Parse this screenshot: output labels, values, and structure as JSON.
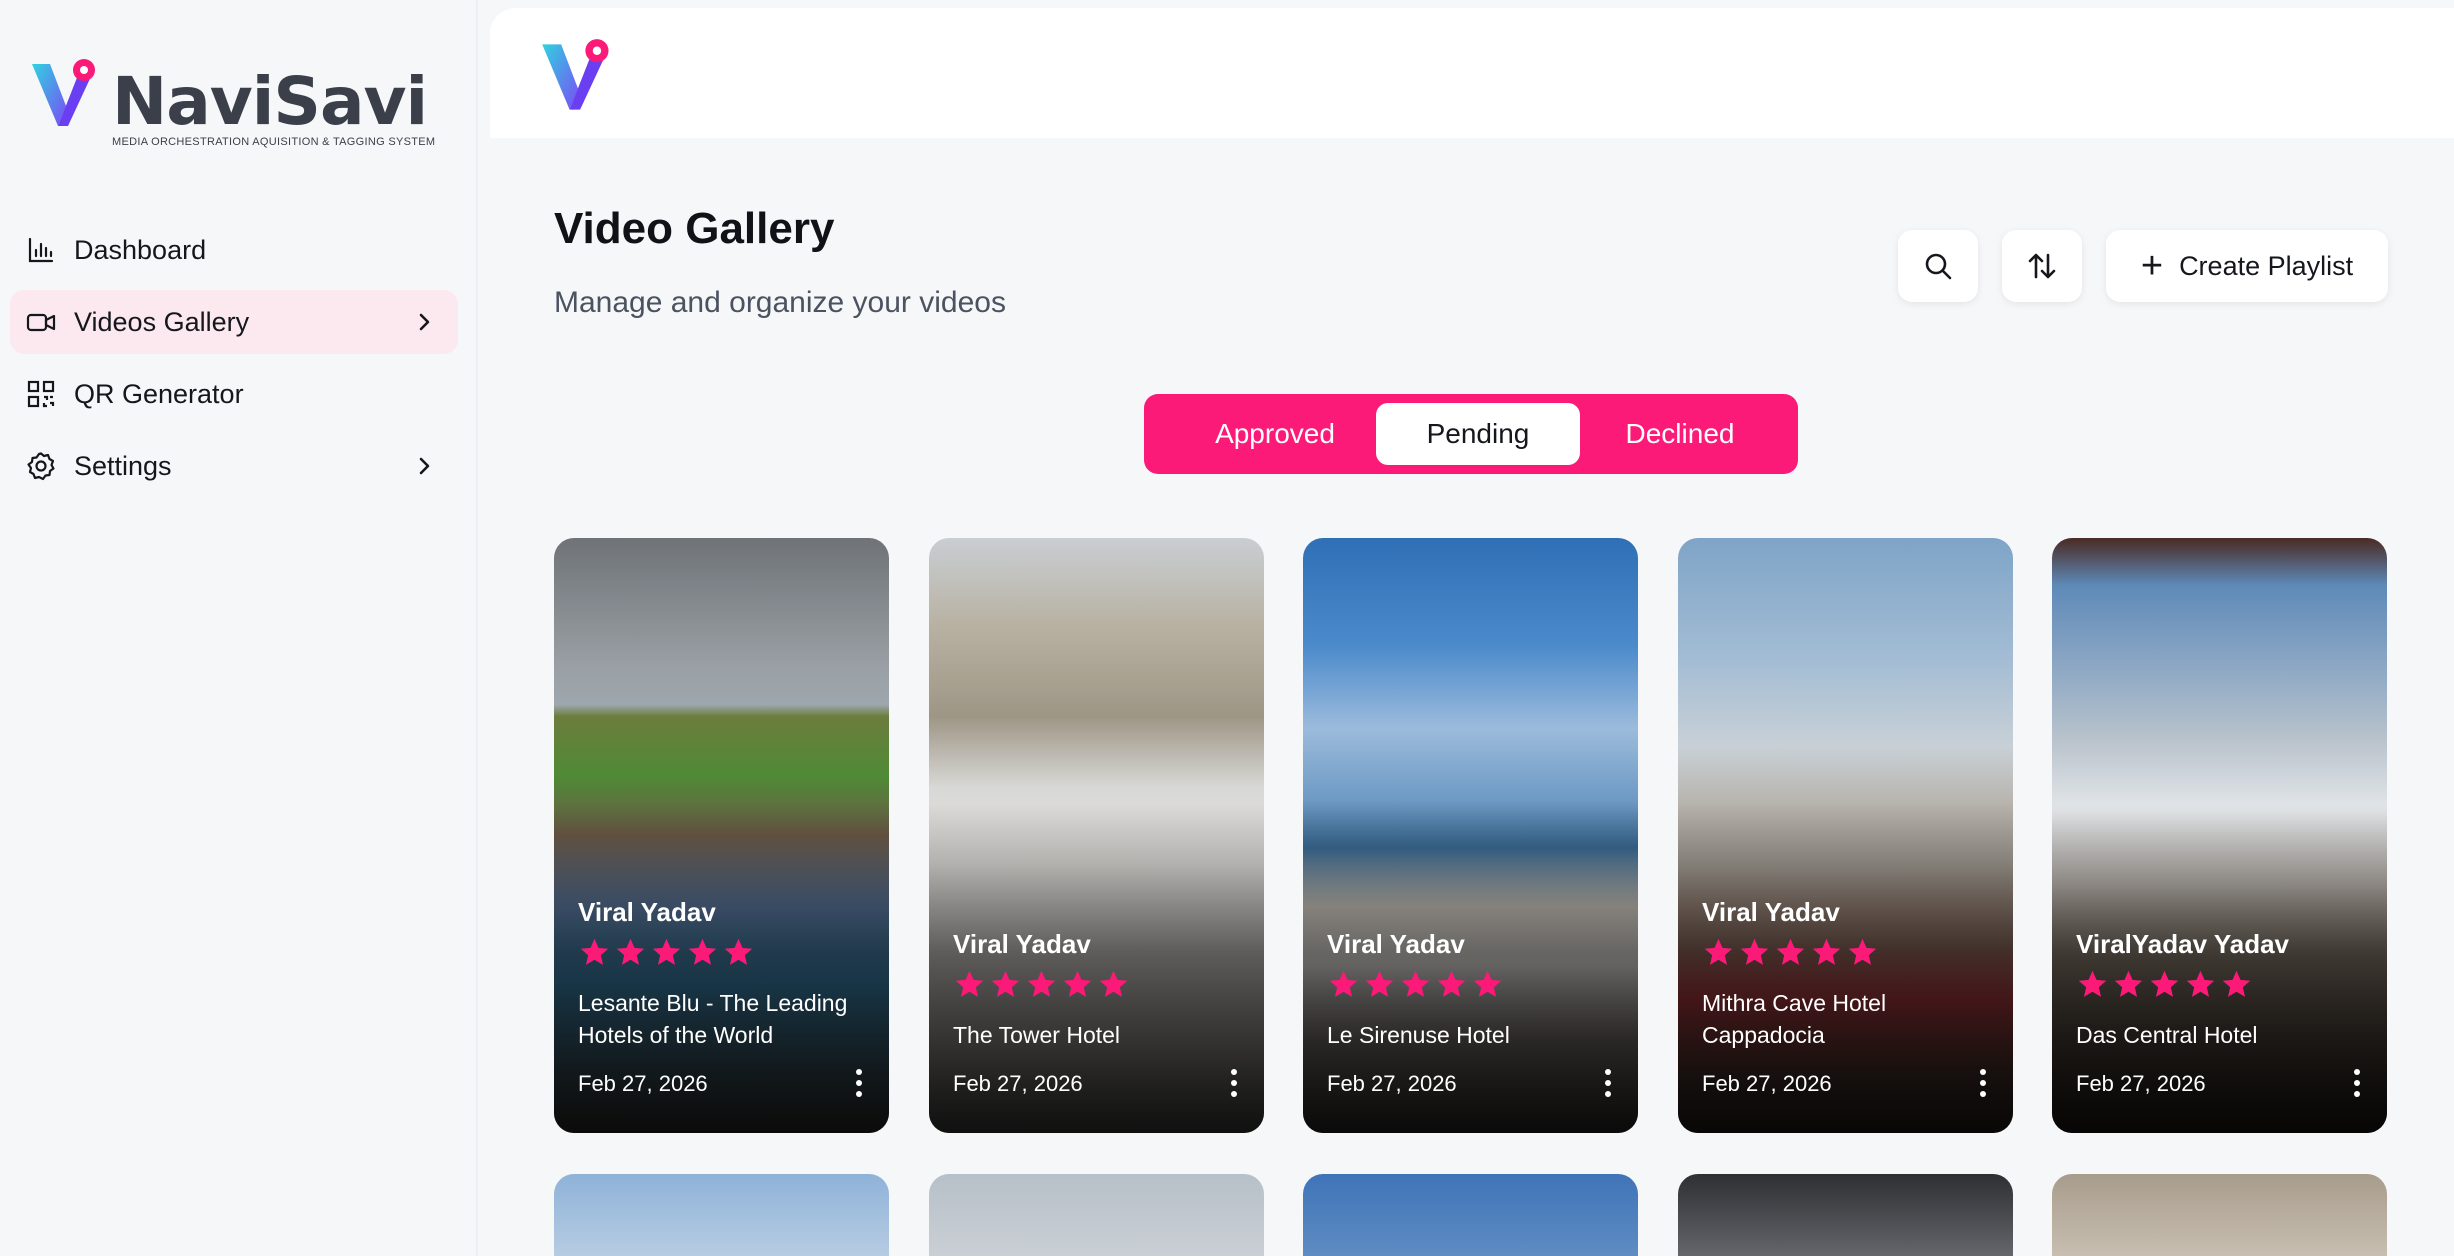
{
  "brand": {
    "name": "NaviSavi",
    "tagline": "MEDIA ORCHESTRATION AQUISITION & TAGGING SYSTEM",
    "accent": "#fb1a78"
  },
  "sidebar": {
    "items": [
      {
        "label": "Dashboard",
        "icon": "bar-chart-icon",
        "active": false
      },
      {
        "label": "Videos Gallery",
        "icon": "video-camera-icon",
        "active": true
      },
      {
        "label": "QR Generator",
        "icon": "qr-code-icon",
        "active": false
      },
      {
        "label": "Settings",
        "icon": "gear-icon",
        "active": false
      }
    ]
  },
  "header": {
    "title": "Video Gallery",
    "subtitle": "Manage and organize your videos"
  },
  "actions": {
    "search_icon": "search-icon",
    "sort_icon": "sort-icon",
    "create_label": "Create Playlist"
  },
  "tabs": [
    {
      "label": "Approved",
      "active": false
    },
    {
      "label": "Pending",
      "active": true
    },
    {
      "label": "Declined",
      "active": false
    }
  ],
  "videos": [
    {
      "creator": "Viral Yadav",
      "rating": 5,
      "hotel": "Lesante Blu - The Leading Hotels of the World",
      "date": "Feb 27, 2026"
    },
    {
      "creator": "Viral Yadav",
      "rating": 5,
      "hotel": "The Tower Hotel",
      "date": "Feb 27, 2026"
    },
    {
      "creator": "Viral Yadav",
      "rating": 5,
      "hotel": "Le Sirenuse Hotel",
      "date": "Feb 27, 2026"
    },
    {
      "creator": "Viral Yadav",
      "rating": 5,
      "hotel": "Mithra Cave Hotel Cappadocia",
      "date": "Feb 27, 2026"
    },
    {
      "creator": "ViralYadav Yadav",
      "rating": 5,
      "hotel": "Das Central Hotel",
      "date": "Feb 27, 2026"
    }
  ]
}
